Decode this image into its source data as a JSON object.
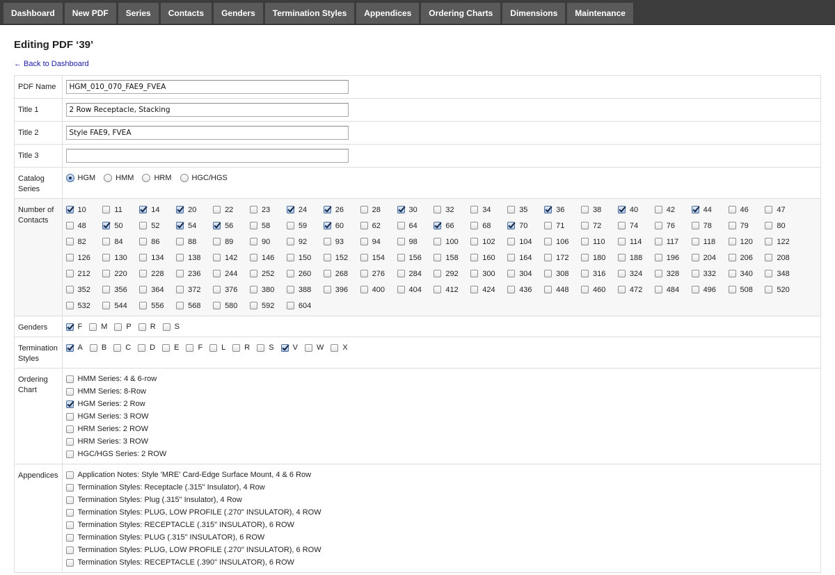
{
  "nav": [
    "Dashboard",
    "New PDF",
    "Series",
    "Contacts",
    "Genders",
    "Termination Styles",
    "Appendices",
    "Ordering Charts",
    "Dimensions",
    "Maintenance"
  ],
  "page_title": "Editing PDF ‘39’",
  "back_link": "← Back to Dashboard",
  "labels": {
    "pdf_name": "PDF Name",
    "title1": "Title 1",
    "title2": "Title 2",
    "title3": "Title 3",
    "catalog_series": "Catalog Series",
    "contacts": "Number of Contacts",
    "genders": "Genders",
    "termination": "Termination Styles",
    "ordering_chart": "Ordering Chart",
    "appendices": "Appendices"
  },
  "fields": {
    "pdf_name": "HGM_010_070_FAE9_FVEA",
    "title1": "2 Row Receptacle, Stacking",
    "title2": "Style FAE9, FVEA",
    "title3": ""
  },
  "catalog_series": [
    {
      "label": "HGM",
      "selected": true
    },
    {
      "label": "HMM",
      "selected": false
    },
    {
      "label": "HRM",
      "selected": false
    },
    {
      "label": "HGC/HGS",
      "selected": false
    }
  ],
  "contacts": [
    {
      "label": "10",
      "checked": true
    },
    {
      "label": "11",
      "checked": false
    },
    {
      "label": "14",
      "checked": true
    },
    {
      "label": "20",
      "checked": true
    },
    {
      "label": "22",
      "checked": false
    },
    {
      "label": "23",
      "checked": false
    },
    {
      "label": "24",
      "checked": true
    },
    {
      "label": "26",
      "checked": true
    },
    {
      "label": "28",
      "checked": false
    },
    {
      "label": "30",
      "checked": true
    },
    {
      "label": "32",
      "checked": false
    },
    {
      "label": "34",
      "checked": false
    },
    {
      "label": "35",
      "checked": false
    },
    {
      "label": "36",
      "checked": true
    },
    {
      "label": "38",
      "checked": false
    },
    {
      "label": "40",
      "checked": true
    },
    {
      "label": "42",
      "checked": false
    },
    {
      "label": "44",
      "checked": true
    },
    {
      "label": "46",
      "checked": false
    },
    {
      "label": "47",
      "checked": false
    },
    {
      "label": "48",
      "checked": false
    },
    {
      "label": "50",
      "checked": true
    },
    {
      "label": "52",
      "checked": false
    },
    {
      "label": "54",
      "checked": true
    },
    {
      "label": "56",
      "checked": true
    },
    {
      "label": "58",
      "checked": false
    },
    {
      "label": "59",
      "checked": false
    },
    {
      "label": "60",
      "checked": true
    },
    {
      "label": "62",
      "checked": false
    },
    {
      "label": "64",
      "checked": false
    },
    {
      "label": "66",
      "checked": true
    },
    {
      "label": "68",
      "checked": false
    },
    {
      "label": "70",
      "checked": true
    },
    {
      "label": "71",
      "checked": false
    },
    {
      "label": "72",
      "checked": false
    },
    {
      "label": "74",
      "checked": false
    },
    {
      "label": "76",
      "checked": false
    },
    {
      "label": "78",
      "checked": false
    },
    {
      "label": "79",
      "checked": false
    },
    {
      "label": "80",
      "checked": false
    },
    {
      "label": "82",
      "checked": false
    },
    {
      "label": "84",
      "checked": false
    },
    {
      "label": "86",
      "checked": false
    },
    {
      "label": "88",
      "checked": false
    },
    {
      "label": "89",
      "checked": false
    },
    {
      "label": "90",
      "checked": false
    },
    {
      "label": "92",
      "checked": false
    },
    {
      "label": "93",
      "checked": false
    },
    {
      "label": "94",
      "checked": false
    },
    {
      "label": "98",
      "checked": false
    },
    {
      "label": "100",
      "checked": false
    },
    {
      "label": "102",
      "checked": false
    },
    {
      "label": "104",
      "checked": false
    },
    {
      "label": "106",
      "checked": false
    },
    {
      "label": "110",
      "checked": false
    },
    {
      "label": "114",
      "checked": false
    },
    {
      "label": "117",
      "checked": false
    },
    {
      "label": "118",
      "checked": false
    },
    {
      "label": "120",
      "checked": false
    },
    {
      "label": "122",
      "checked": false
    },
    {
      "label": "126",
      "checked": false
    },
    {
      "label": "130",
      "checked": false
    },
    {
      "label": "134",
      "checked": false
    },
    {
      "label": "138",
      "checked": false
    },
    {
      "label": "142",
      "checked": false
    },
    {
      "label": "146",
      "checked": false
    },
    {
      "label": "150",
      "checked": false
    },
    {
      "label": "152",
      "checked": false
    },
    {
      "label": "154",
      "checked": false
    },
    {
      "label": "156",
      "checked": false
    },
    {
      "label": "158",
      "checked": false
    },
    {
      "label": "160",
      "checked": false
    },
    {
      "label": "164",
      "checked": false
    },
    {
      "label": "172",
      "checked": false
    },
    {
      "label": "180",
      "checked": false
    },
    {
      "label": "188",
      "checked": false
    },
    {
      "label": "196",
      "checked": false
    },
    {
      "label": "204",
      "checked": false
    },
    {
      "label": "206",
      "checked": false
    },
    {
      "label": "208",
      "checked": false
    },
    {
      "label": "212",
      "checked": false
    },
    {
      "label": "220",
      "checked": false
    },
    {
      "label": "228",
      "checked": false
    },
    {
      "label": "236",
      "checked": false
    },
    {
      "label": "244",
      "checked": false
    },
    {
      "label": "252",
      "checked": false
    },
    {
      "label": "260",
      "checked": false
    },
    {
      "label": "268",
      "checked": false
    },
    {
      "label": "276",
      "checked": false
    },
    {
      "label": "284",
      "checked": false
    },
    {
      "label": "292",
      "checked": false
    },
    {
      "label": "300",
      "checked": false
    },
    {
      "label": "304",
      "checked": false
    },
    {
      "label": "308",
      "checked": false
    },
    {
      "label": "316",
      "checked": false
    },
    {
      "label": "324",
      "checked": false
    },
    {
      "label": "328",
      "checked": false
    },
    {
      "label": "332",
      "checked": false
    },
    {
      "label": "340",
      "checked": false
    },
    {
      "label": "348",
      "checked": false
    },
    {
      "label": "352",
      "checked": false
    },
    {
      "label": "356",
      "checked": false
    },
    {
      "label": "364",
      "checked": false
    },
    {
      "label": "372",
      "checked": false
    },
    {
      "label": "376",
      "checked": false
    },
    {
      "label": "380",
      "checked": false
    },
    {
      "label": "388",
      "checked": false
    },
    {
      "label": "396",
      "checked": false
    },
    {
      "label": "400",
      "checked": false
    },
    {
      "label": "404",
      "checked": false
    },
    {
      "label": "412",
      "checked": false
    },
    {
      "label": "424",
      "checked": false
    },
    {
      "label": "436",
      "checked": false
    },
    {
      "label": "448",
      "checked": false
    },
    {
      "label": "460",
      "checked": false
    },
    {
      "label": "472",
      "checked": false
    },
    {
      "label": "484",
      "checked": false
    },
    {
      "label": "496",
      "checked": false
    },
    {
      "label": "508",
      "checked": false
    },
    {
      "label": "520",
      "checked": false
    },
    {
      "label": "532",
      "checked": false
    },
    {
      "label": "544",
      "checked": false
    },
    {
      "label": "556",
      "checked": false
    },
    {
      "label": "568",
      "checked": false
    },
    {
      "label": "580",
      "checked": false
    },
    {
      "label": "592",
      "checked": false
    },
    {
      "label": "604",
      "checked": false
    }
  ],
  "genders": [
    {
      "label": "F",
      "checked": true
    },
    {
      "label": "M",
      "checked": false
    },
    {
      "label": "P",
      "checked": false
    },
    {
      "label": "R",
      "checked": false
    },
    {
      "label": "S",
      "checked": false
    }
  ],
  "termination_styles": [
    {
      "label": "A",
      "checked": true
    },
    {
      "label": "B",
      "checked": false
    },
    {
      "label": "C",
      "checked": false
    },
    {
      "label": "D",
      "checked": false
    },
    {
      "label": "E",
      "checked": false
    },
    {
      "label": "F",
      "checked": false
    },
    {
      "label": "L",
      "checked": false
    },
    {
      "label": "R",
      "checked": false
    },
    {
      "label": "S",
      "checked": false
    },
    {
      "label": "V",
      "checked": true
    },
    {
      "label": "W",
      "checked": false
    },
    {
      "label": "X",
      "checked": false
    }
  ],
  "ordering_charts": [
    {
      "label": "HMM Series: 4 & 6-row",
      "checked": false
    },
    {
      "label": "HMM Series: 8-Row",
      "checked": false
    },
    {
      "label": "HGM Series: 2 Row",
      "checked": true
    },
    {
      "label": "HGM Series: 3 ROW",
      "checked": false
    },
    {
      "label": "HRM Series: 2 ROW",
      "checked": false
    },
    {
      "label": "HRM Series: 3 ROW",
      "checked": false
    },
    {
      "label": "HGC/HGS Series: 2 ROW",
      "checked": false
    }
  ],
  "appendices": [
    {
      "label": "Application Notes: Style 'MRE' Card-Edge Surface Mount, 4 & 6 Row",
      "checked": false
    },
    {
      "label": "Termination Styles: Receptacle (.315\" Insulator), 4 Row",
      "checked": false
    },
    {
      "label": "Termination Styles: Plug (.315\" Insulator), 4 Row",
      "checked": false
    },
    {
      "label": "Termination Styles: PLUG, LOW PROFILE (.270\" INSULATOR), 4 ROW",
      "checked": false
    },
    {
      "label": "Termination Styles: RECEPTACLE (.315\" INSULATOR), 6 ROW",
      "checked": false
    },
    {
      "label": "Termination Styles: PLUG (.315\" INSULATOR), 6 ROW",
      "checked": false
    },
    {
      "label": "Termination Styles: PLUG, LOW PROFILE (.270\" INSULATOR), 6 ROW",
      "checked": false
    },
    {
      "label": "Termination Styles: RECEPTACLE (.390\" INSULATOR), 6 ROW",
      "checked": false
    }
  ]
}
